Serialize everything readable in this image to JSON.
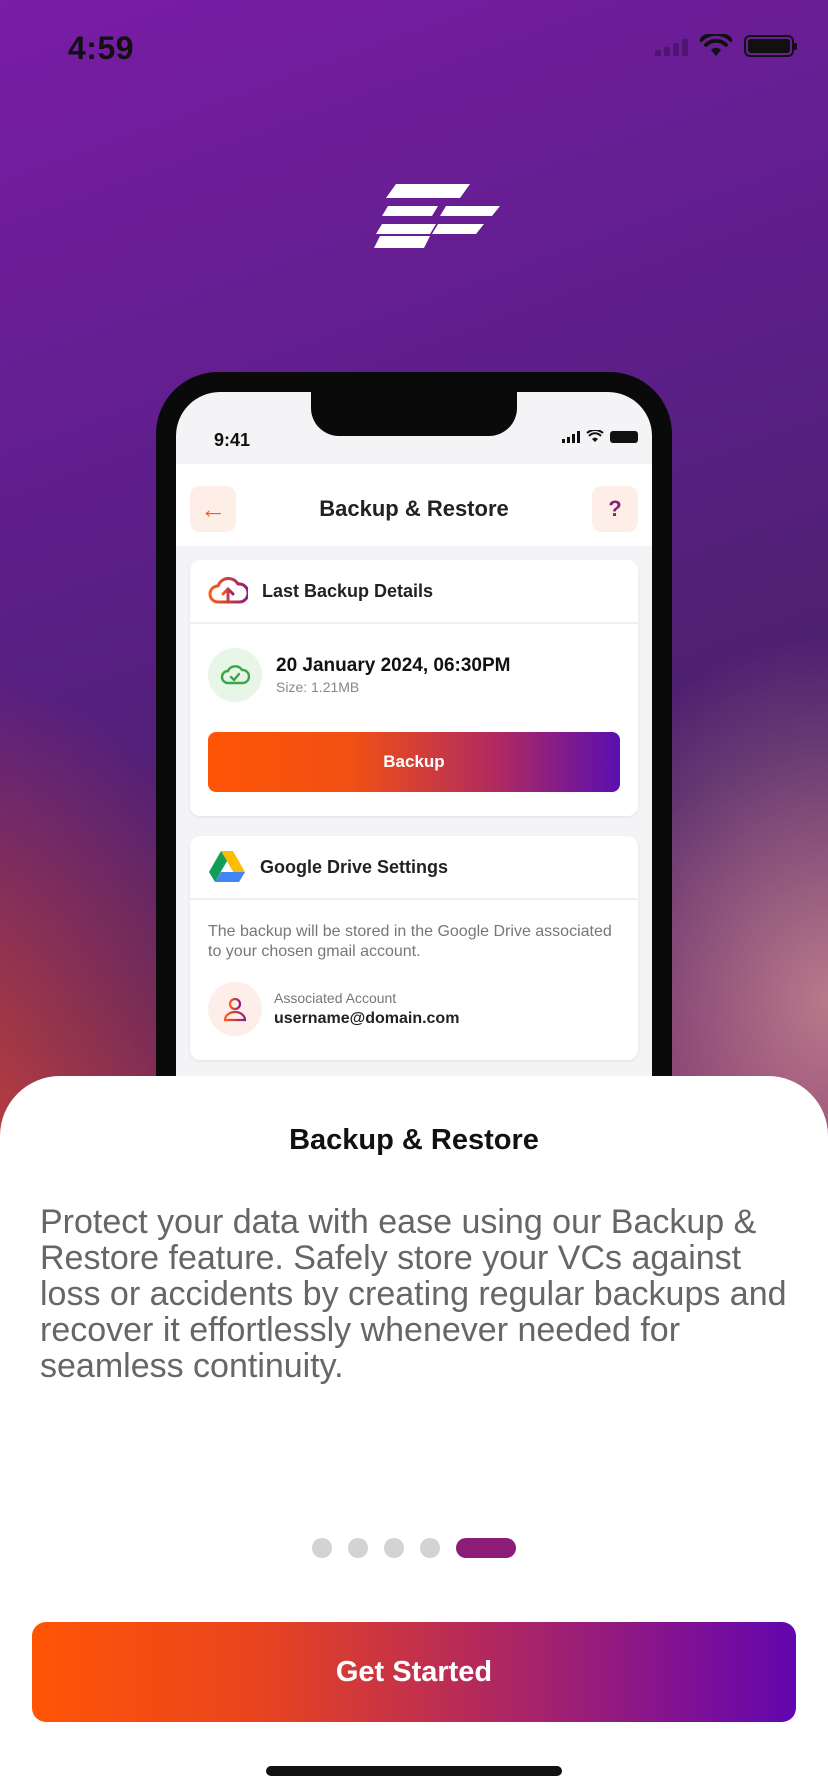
{
  "status_bar": {
    "time": "4:59"
  },
  "mockup": {
    "status_time": "9:41",
    "header_title": "Backup & Restore",
    "back_icon": "arrow-left-icon",
    "help_label": "?",
    "last_backup": {
      "title": "Last Backup Details",
      "date": "20 January 2024, 06:30PM",
      "size": "Size: 1.21MB",
      "button_label": "Backup"
    },
    "drive": {
      "title": "Google Drive Settings",
      "description": "The backup will be stored in the Google Drive associated to your chosen gmail account.",
      "account_label": "Associated Account",
      "account_email": "username@domain.com"
    }
  },
  "sheet": {
    "title": "Backup & Restore",
    "description": "Protect your data with ease using our Backup & Restore feature. Safely store your VCs against loss or accidents by creating regular backups and recover it effortlessly whenever needed for seamless continuity.",
    "pagination": {
      "total": 5,
      "current": 5
    },
    "cta_label": "Get Started"
  },
  "colors": {
    "accent_orange": "#ff5505",
    "accent_purple": "#6205b0",
    "active_dot": "#8c1c76"
  }
}
